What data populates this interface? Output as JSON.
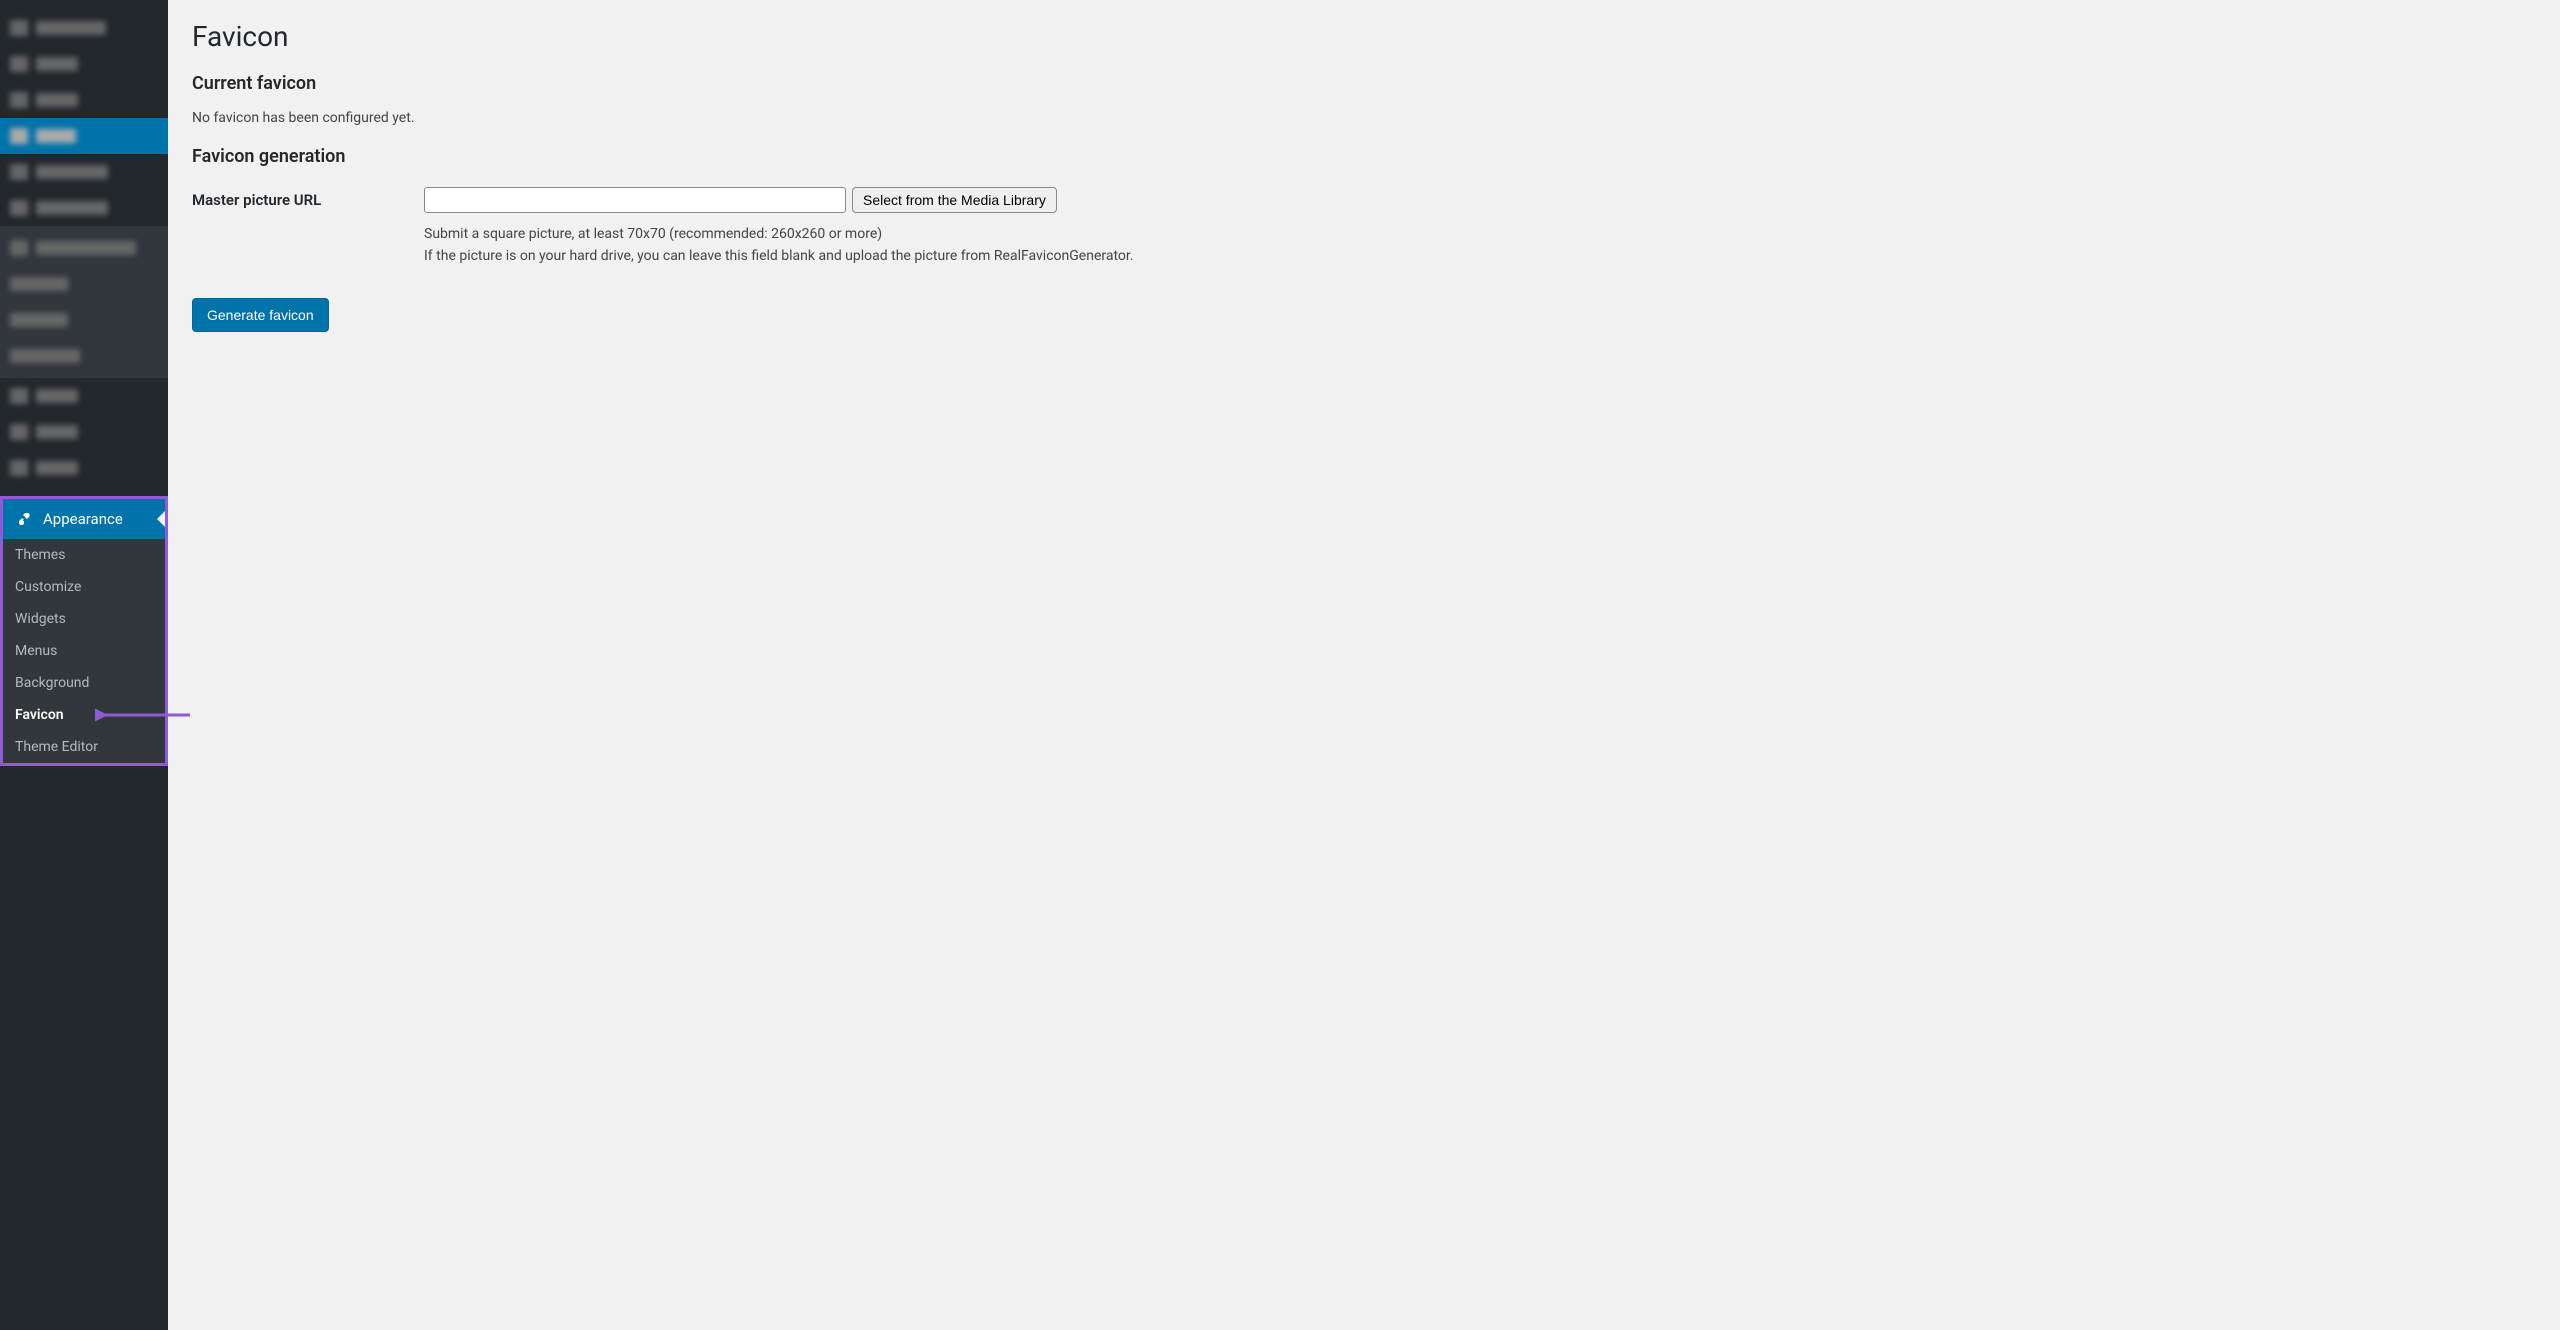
{
  "sidebar": {
    "appearance": {
      "label": "Appearance",
      "submenu": [
        {
          "label": "Themes"
        },
        {
          "label": "Customize"
        },
        {
          "label": "Widgets"
        },
        {
          "label": "Menus"
        },
        {
          "label": "Background"
        },
        {
          "label": "Favicon"
        },
        {
          "label": "Theme Editor"
        }
      ]
    }
  },
  "main": {
    "title": "Favicon",
    "current_heading": "Current favicon",
    "current_status": "No favicon has been configured yet.",
    "generation_heading": "Favicon generation",
    "form": {
      "label": "Master picture URL",
      "media_button": "Select from the Media Library",
      "help_line1": "Submit a square picture, at least 70x70 (recommended: 260x260 or more)",
      "help_line2": "If the picture is on your hard drive, you can leave this field blank and upload the picture from RealFaviconGenerator."
    },
    "generate_button": "Generate favicon"
  }
}
